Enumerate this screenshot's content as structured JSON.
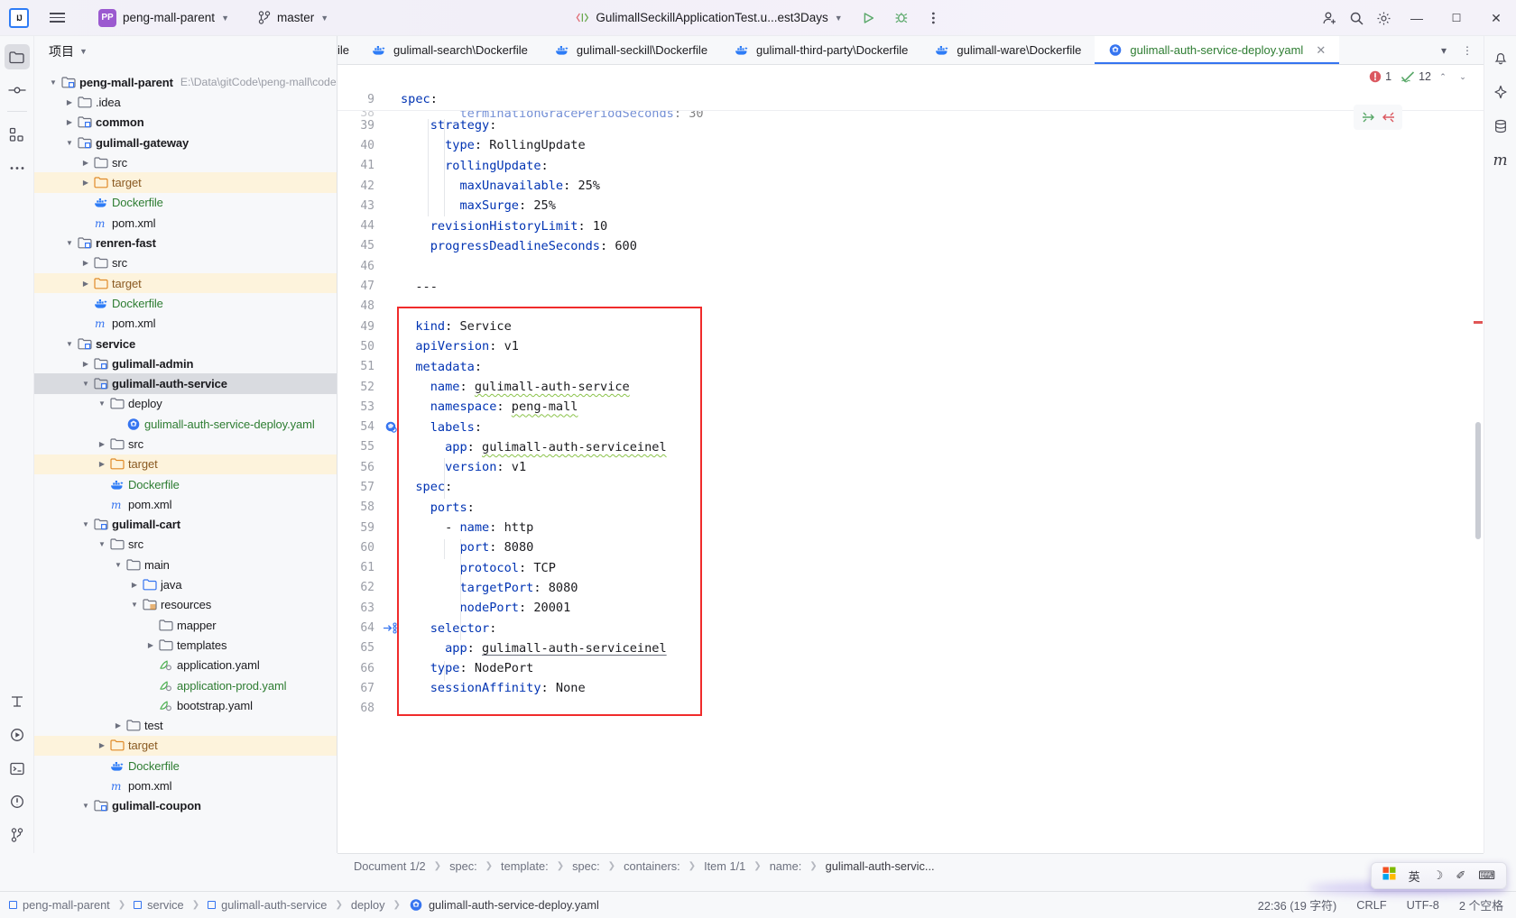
{
  "titlebar": {
    "logo": "IJ",
    "menu_icon": "hamburger-icon",
    "project_badge": "PP",
    "project_name": "peng-mall-parent",
    "branch_icon": "git-branch-icon",
    "branch_name": "master",
    "run_config": "GulimallSeckillApplicationTest.u...est3Days",
    "run_icon": "run-icon",
    "debug_icon": "debug-icon",
    "more_icon": "more-vertical-icon",
    "account_icon": "add-user-icon",
    "search_icon": "search-icon",
    "settings_icon": "gear-icon",
    "minimize": "—",
    "maximize": "☐",
    "close": "✕",
    "accent": "#3574F0"
  },
  "left_rail": [
    {
      "name": "project-tool-icon",
      "active": true
    },
    {
      "name": "commit-tool-icon",
      "active": false
    },
    {
      "name": "structure-tool-icon",
      "active": false
    },
    {
      "name": "more-tools-icon",
      "active": false
    }
  ],
  "left_rail_bottom": [
    {
      "name": "profiler-icon"
    },
    {
      "name": "run-tool-icon"
    },
    {
      "name": "terminal-icon"
    },
    {
      "name": "problems-icon"
    },
    {
      "name": "version-control-icon"
    }
  ],
  "right_rail": [
    {
      "name": "notifications-icon",
      "glyph": "🔔"
    },
    {
      "name": "ai-assistant-icon",
      "glyph": "✦"
    },
    {
      "name": "database-icon",
      "glyph": "⛁"
    },
    {
      "name": "maven-icon",
      "glyph": "m"
    }
  ],
  "project_panel": {
    "title": "项目",
    "chevron": "⌄",
    "tree": [
      {
        "depth": 0,
        "arrow": "down",
        "icon": "module-folder-icon",
        "label": "peng-mall-parent",
        "bold": true,
        "hint": "E:\\Data\\gitCode\\peng-mall\\code"
      },
      {
        "depth": 1,
        "arrow": "right",
        "icon": "folder-icon",
        "label": ".idea"
      },
      {
        "depth": 1,
        "arrow": "right",
        "icon": "module-folder-icon",
        "label": "common",
        "bold": true
      },
      {
        "depth": 1,
        "arrow": "down",
        "icon": "module-folder-icon",
        "label": "gulimall-gateway",
        "bold": true
      },
      {
        "depth": 2,
        "arrow": "right",
        "icon": "folder-icon",
        "label": "src"
      },
      {
        "depth": 2,
        "arrow": "right",
        "icon": "target-folder-icon",
        "label": "target",
        "highlight": true,
        "color": "orange"
      },
      {
        "depth": 2,
        "arrow": "none",
        "icon": "docker-icon",
        "label": "Dockerfile",
        "color": "green"
      },
      {
        "depth": 2,
        "arrow": "none",
        "icon": "maven-m-icon",
        "label": "pom.xml"
      },
      {
        "depth": 1,
        "arrow": "down",
        "icon": "module-folder-icon",
        "label": "renren-fast",
        "bold": true
      },
      {
        "depth": 2,
        "arrow": "right",
        "icon": "folder-icon",
        "label": "src"
      },
      {
        "depth": 2,
        "arrow": "right",
        "icon": "target-folder-icon",
        "label": "target",
        "highlight": true,
        "color": "orange"
      },
      {
        "depth": 2,
        "arrow": "none",
        "icon": "docker-icon",
        "label": "Dockerfile",
        "color": "green"
      },
      {
        "depth": 2,
        "arrow": "none",
        "icon": "maven-m-icon",
        "label": "pom.xml"
      },
      {
        "depth": 1,
        "arrow": "down",
        "icon": "module-folder-icon",
        "label": "service",
        "bold": true
      },
      {
        "depth": 2,
        "arrow": "right",
        "icon": "module-folder-icon",
        "label": "gulimall-admin",
        "bold": true
      },
      {
        "depth": 2,
        "arrow": "down",
        "icon": "module-folder-icon",
        "label": "gulimall-auth-service",
        "bold": true,
        "selected": true
      },
      {
        "depth": 3,
        "arrow": "down",
        "icon": "folder-icon",
        "label": "deploy"
      },
      {
        "depth": 4,
        "arrow": "none",
        "icon": "kubernetes-icon",
        "label": "gulimall-auth-service-deploy.yaml",
        "color": "green"
      },
      {
        "depth": 3,
        "arrow": "right",
        "icon": "folder-icon",
        "label": "src"
      },
      {
        "depth": 3,
        "arrow": "right",
        "icon": "target-folder-icon",
        "label": "target",
        "highlight": true,
        "color": "orange"
      },
      {
        "depth": 3,
        "arrow": "none",
        "icon": "docker-icon",
        "label": "Dockerfile",
        "color": "green"
      },
      {
        "depth": 3,
        "arrow": "none",
        "icon": "maven-m-icon",
        "label": "pom.xml"
      },
      {
        "depth": 2,
        "arrow": "down",
        "icon": "module-folder-icon",
        "label": "gulimall-cart",
        "bold": true
      },
      {
        "depth": 3,
        "arrow": "down",
        "icon": "folder-icon",
        "label": "src"
      },
      {
        "depth": 4,
        "arrow": "down",
        "icon": "folder-icon",
        "label": "main"
      },
      {
        "depth": 5,
        "arrow": "right",
        "icon": "source-folder-icon",
        "label": "java"
      },
      {
        "depth": 5,
        "arrow": "down",
        "icon": "resources-folder-icon",
        "label": "resources"
      },
      {
        "depth": 6,
        "arrow": "none",
        "icon": "folder-icon",
        "label": "mapper"
      },
      {
        "depth": 6,
        "arrow": "right",
        "icon": "folder-icon",
        "label": "templates"
      },
      {
        "depth": 6,
        "arrow": "none",
        "icon": "yaml-icon",
        "label": "application.yaml"
      },
      {
        "depth": 6,
        "arrow": "none",
        "icon": "yaml-icon",
        "label": "application-prod.yaml",
        "color": "green"
      },
      {
        "depth": 6,
        "arrow": "none",
        "icon": "yaml-icon",
        "label": "bootstrap.yaml"
      },
      {
        "depth": 4,
        "arrow": "right",
        "icon": "folder-icon",
        "label": "test"
      },
      {
        "depth": 3,
        "arrow": "right",
        "icon": "target-folder-icon",
        "label": "target",
        "highlight": true,
        "color": "orange"
      },
      {
        "depth": 3,
        "arrow": "none",
        "icon": "docker-icon",
        "label": "Dockerfile",
        "color": "green"
      },
      {
        "depth": 3,
        "arrow": "none",
        "icon": "maven-m-icon",
        "label": "pom.xml"
      },
      {
        "depth": 2,
        "arrow": "down",
        "icon": "module-folder-icon",
        "label": "gulimall-coupon",
        "bold": true
      }
    ]
  },
  "editor": {
    "tabs": [
      {
        "label": "ile",
        "icon": "docker-icon",
        "active": false,
        "clipped": true
      },
      {
        "label": "gulimall-search\\Dockerfile",
        "icon": "docker-icon",
        "active": false
      },
      {
        "label": "gulimall-seckill\\Dockerfile",
        "icon": "docker-icon",
        "active": false
      },
      {
        "label": "gulimall-third-party\\Dockerfile",
        "icon": "docker-icon",
        "active": false
      },
      {
        "label": "gulimall-ware\\Dockerfile",
        "icon": "docker-icon",
        "active": false
      },
      {
        "label": "gulimall-auth-service-deploy.yaml",
        "icon": "kubernetes-icon",
        "active": true,
        "close": "✕"
      }
    ],
    "tab_actions": [
      "list-tabs-icon",
      "more-options-icon"
    ],
    "inspection": {
      "error_count": "1",
      "warning_count": "12",
      "error_icon": "error-circle-icon",
      "check_icon": "inspection-check-icon",
      "up_icon": "⌃",
      "down_icon": "⌄"
    },
    "floating_actions": [
      "expand-all-icon",
      "collapse-all-icon"
    ],
    "sticky_header": {
      "num": "9",
      "text": "spec:"
    },
    "lines": [
      {
        "num": "39",
        "indent": 2,
        "key": "strategy",
        "value": "",
        "colon": true
      },
      {
        "num": "40",
        "indent": 3,
        "key": "type",
        "value": "RollingUpdate"
      },
      {
        "num": "41",
        "indent": 3,
        "key": "rollingUpdate",
        "value": "",
        "colon": true
      },
      {
        "num": "42",
        "indent": 4,
        "key": "maxUnavailable",
        "value": "25%"
      },
      {
        "num": "43",
        "indent": 4,
        "key": "maxSurge",
        "value": "25%"
      },
      {
        "num": "44",
        "indent": 2,
        "key": "revisionHistoryLimit",
        "value": "10"
      },
      {
        "num": "45",
        "indent": 2,
        "key": "progressDeadlineSeconds",
        "value": "600"
      },
      {
        "num": "46",
        "indent": 0,
        "raw": ""
      },
      {
        "num": "47",
        "indent": 1,
        "raw": "---"
      },
      {
        "num": "48",
        "indent": 0,
        "raw": ""
      },
      {
        "num": "49",
        "indent": 1,
        "key": "kind",
        "value": "Service"
      },
      {
        "num": "50",
        "indent": 1,
        "key": "apiVersion",
        "value": "v1"
      },
      {
        "num": "51",
        "indent": 1,
        "key": "metadata",
        "value": "",
        "colon": true
      },
      {
        "num": "52",
        "indent": 2,
        "key": "name",
        "value": "gulimall-auth-service",
        "squiggle": true
      },
      {
        "num": "53",
        "indent": 2,
        "key": "namespace",
        "value": "peng-mall",
        "squiggle": true
      },
      {
        "num": "54",
        "indent": 2,
        "key": "labels",
        "value": "",
        "colon": true,
        "gutter_icon": "kubernetes-gutter-icon"
      },
      {
        "num": "55",
        "indent": 3,
        "key": "app",
        "value": "gulimall-auth-serviceinel",
        "squiggle": true
      },
      {
        "num": "56",
        "indent": 3,
        "key": "version",
        "value": "v1"
      },
      {
        "num": "57",
        "indent": 1,
        "key": "spec",
        "value": "",
        "colon": true
      },
      {
        "num": "58",
        "indent": 2,
        "key": "ports",
        "value": "",
        "colon": true
      },
      {
        "num": "59",
        "indent": 3,
        "key": "- name",
        "value": "http",
        "dash": true
      },
      {
        "num": "60",
        "indent": 4,
        "key": "port",
        "value": "8080"
      },
      {
        "num": "61",
        "indent": 4,
        "key": "protocol",
        "value": "TCP"
      },
      {
        "num": "62",
        "indent": 4,
        "key": "targetPort",
        "value": "8080"
      },
      {
        "num": "63",
        "indent": 4,
        "key": "nodePort",
        "value": "20001"
      },
      {
        "num": "64",
        "indent": 2,
        "key": "selector",
        "value": "",
        "colon": true,
        "gutter_icon": "run-target-icon"
      },
      {
        "num": "65",
        "indent": 3,
        "key": "app",
        "value": "gulimall-auth-serviceinel",
        "squiggle": true,
        "underline": true
      },
      {
        "num": "66",
        "indent": 2,
        "key": "type",
        "value": "NodePort"
      },
      {
        "num": "67",
        "indent": 2,
        "key": "sessionAffinity",
        "value": "None"
      },
      {
        "num": "68",
        "indent": 0,
        "raw": ""
      }
    ],
    "highlight_box_color": "#F02B2B",
    "breadcrumbs": [
      "Document 1/2",
      "spec:",
      "template:",
      "spec:",
      "containers:",
      "Item 1/1",
      "name:",
      "gulimall-auth-servic..."
    ]
  },
  "status_bar": {
    "path": [
      {
        "label": "peng-mall-parent",
        "icon": "module-box-icon"
      },
      {
        "label": "service",
        "icon": "module-box-icon"
      },
      {
        "label": "gulimall-auth-service",
        "icon": "module-box-icon"
      },
      {
        "label": "deploy",
        "icon": ""
      },
      {
        "label": "gulimall-auth-service-deploy.yaml",
        "icon": "kubernetes-icon"
      }
    ],
    "caret": "22:36 (19 字符)",
    "line_separator": "CRLF",
    "encoding": "UTF-8",
    "indent": "2 个空格"
  },
  "ime_popup": {
    "lang_icon": "windows-ime-icon",
    "mode": "英",
    "moon": "☽",
    "pen": "✐",
    "keyboard": "⌨"
  }
}
